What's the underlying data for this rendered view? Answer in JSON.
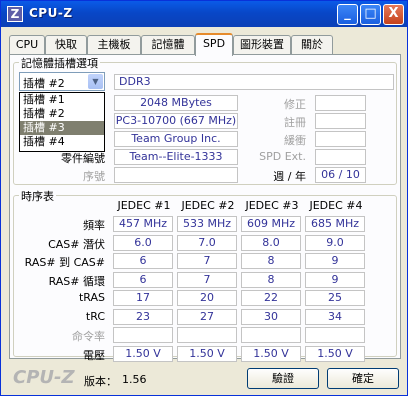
{
  "window": {
    "title": "CPU-Z",
    "icon_letter": "Z"
  },
  "titlebar": {
    "min": "_",
    "max": "□",
    "close": "X"
  },
  "tabs": [
    "CPU",
    "快取",
    "主機板",
    "記憶體",
    "SPD",
    "圖形裝置",
    "關於"
  ],
  "active_tab": "SPD",
  "slot": {
    "legend": "記憶體插槽選項",
    "selected": "插槽 #2",
    "options": [
      "插槽 #1",
      "插槽 #2",
      "插槽 #3",
      "插槽 #4"
    ],
    "highlighted": "插槽 #3",
    "type": "DDR3",
    "size": "2048 MBytes",
    "bandwidth": "PC3-10700 (667 MHz)",
    "manufacturer": "Team Group Inc.",
    "part_label": "零件編號",
    "part_number": "Team--Elite-1333",
    "serial_label": "序號",
    "serial": "",
    "correction_label": "修正",
    "correction": "",
    "registered_label": "註冊",
    "registered": "",
    "buffered_label": "緩衝",
    "buffered": "",
    "spd_ext_label": "SPD Ext.",
    "spd_ext": "",
    "week_year_label": "週 / 年",
    "week_year": "06 / 10"
  },
  "timings": {
    "legend": "時序表",
    "columns": [
      "JEDEC #1",
      "JEDEC #2",
      "JEDEC #3",
      "JEDEC #4"
    ],
    "rows": [
      {
        "label": "頻率",
        "values": [
          "457 MHz",
          "533 MHz",
          "609 MHz",
          "685 MHz"
        ]
      },
      {
        "label": "CAS# 潛伏",
        "values": [
          "6.0",
          "7.0",
          "8.0",
          "9.0"
        ]
      },
      {
        "label": "RAS# 到 CAS#",
        "values": [
          "6",
          "7",
          "8",
          "9"
        ]
      },
      {
        "label": "RAS# 循環",
        "values": [
          "6",
          "7",
          "8",
          "9"
        ]
      },
      {
        "label": "tRAS",
        "values": [
          "17",
          "20",
          "22",
          "25"
        ]
      },
      {
        "label": "tRC",
        "values": [
          "23",
          "27",
          "30",
          "34"
        ]
      },
      {
        "label": "命令率",
        "values": [
          "",
          "",
          "",
          ""
        ]
      },
      {
        "label": "電壓",
        "values": [
          "1.50 V",
          "1.50 V",
          "1.50 V",
          "1.50 V"
        ]
      }
    ]
  },
  "footer": {
    "logo": "CPU-Z",
    "version_label": "版本：",
    "version": "1.56",
    "validate_button": "驗證",
    "ok_button": "確定"
  }
}
